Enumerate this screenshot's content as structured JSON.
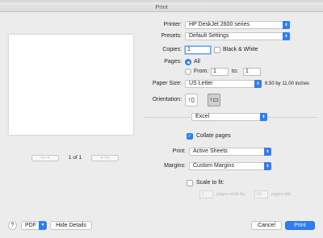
{
  "window": {
    "title": "Print"
  },
  "preview": {
    "page_count": "1 of 1",
    "first_label": "<<  <",
    "next_label": ">  >>"
  },
  "printer": {
    "label": "Printer:",
    "value": "HP DeskJet 2600 series"
  },
  "presets": {
    "label": "Presets:",
    "value": "Default Settings"
  },
  "copies": {
    "label": "Copies:",
    "value": "1",
    "bw_label": "Black & White"
  },
  "pages": {
    "label": "Pages:",
    "all_label": "All",
    "from_label": "From:",
    "from_value": "1",
    "to_label": "to:",
    "to_value": "1"
  },
  "paper": {
    "label": "Paper Size:",
    "value": "US Letter",
    "dims": "8.50 by 11.00 inches"
  },
  "orientation": {
    "label": "Orientation:",
    "portrait_glyph": "↑▯",
    "landscape_glyph": "↑▭"
  },
  "section": {
    "value": "Excel"
  },
  "collate": {
    "label": "Collate pages",
    "checked": true
  },
  "print_what": {
    "label": "Print:",
    "value": "Active Sheets"
  },
  "margins": {
    "label": "Margins:",
    "value": "Custom Margins"
  },
  "scale": {
    "label": "Scale to fit:",
    "pages_wide_value": "1",
    "pages_wide_label": "pages wide by",
    "pages_tall_value": "00",
    "pages_tall_label": "pages tall"
  },
  "footer": {
    "help": "?",
    "pdf": "PDF",
    "hide_details": "Hide Details",
    "cancel": "Cancel",
    "print": "Print"
  },
  "colors": {
    "accent": "#2f7df6"
  }
}
